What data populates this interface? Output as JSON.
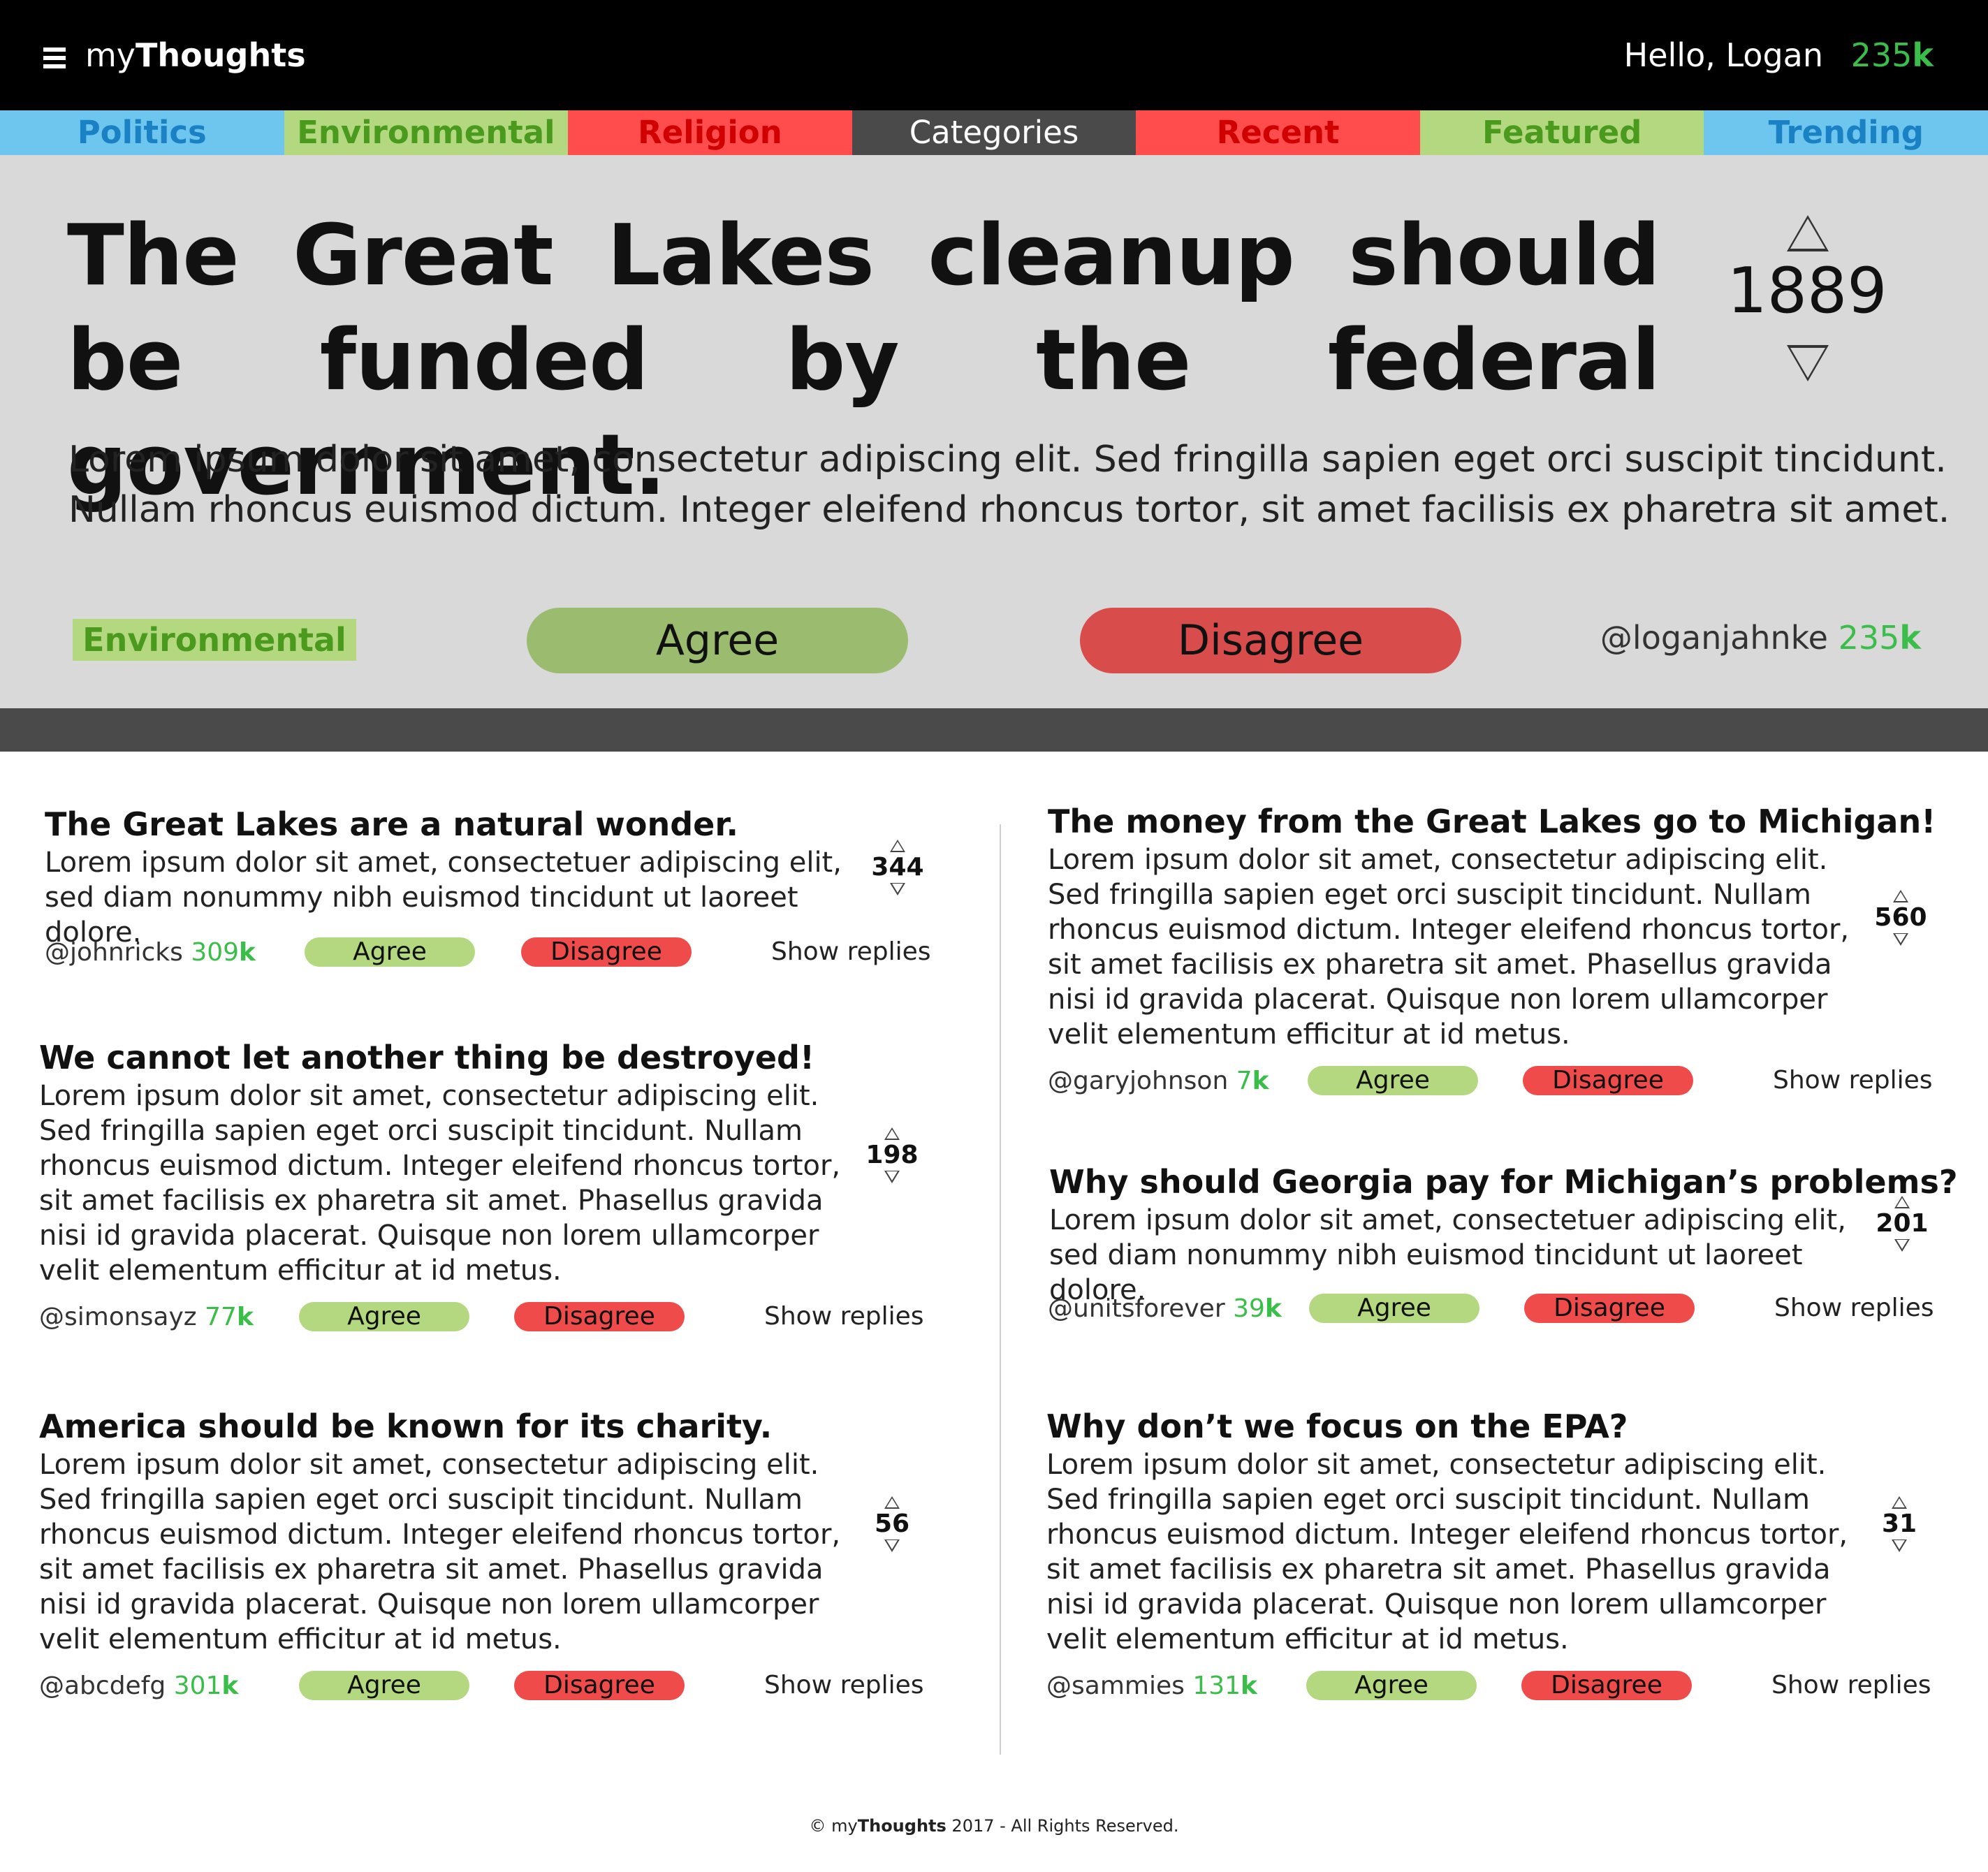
{
  "header": {
    "brand_prefix": "my",
    "brand_bold": "Thoughts",
    "greeting_prefix": "Hello,",
    "user_name": "Logan",
    "points_number": "235",
    "points_suffix": "k"
  },
  "nav": {
    "tabs": [
      {
        "label": "Politics",
        "bg": "#6ec6ee",
        "fg": "#1a82c4"
      },
      {
        "label": "Environmental",
        "bg": "#b3d87f",
        "fg": "#4a9a1e"
      },
      {
        "label": "Religion",
        "bg": "#ff4d4d",
        "fg": "#d00000"
      },
      {
        "label": "Categories",
        "bg": "#4a4a4a",
        "fg": "#ffffff"
      },
      {
        "label": "Recent",
        "bg": "#ff4d4d",
        "fg": "#d00000"
      },
      {
        "label": "Featured",
        "bg": "#b3d87f",
        "fg": "#4a9a1e"
      },
      {
        "label": "Trending",
        "bg": "#6ec6ee",
        "fg": "#1a82c4"
      }
    ]
  },
  "hero": {
    "title": "The Great Lakes cleanup should be funded by the federal government.",
    "votes": "1889",
    "body": "Lorem ipsum dolor sit amet, consectetur adipiscing elit. Sed fringilla sapien eget orci suscipit tincidunt. Nullam rhoncus euismod dictum. Integer eleifend rhoncus tortor, sit amet facilisis ex pharetra sit amet.",
    "category": "Environmental",
    "agree_label": "Agree",
    "disagree_label": "Disagree",
    "author": "@loganjahnke",
    "author_points": "235",
    "author_points_suffix": "k"
  },
  "posts": [
    {
      "title": "The Great Lakes are a natural wonder.",
      "body": "Lorem ipsum dolor sit amet, consectetuer adipiscing elit, sed diam nonummy nibh euismod tincidunt ut laoreet dolore.",
      "votes": "344",
      "author": "@johnricks",
      "points": "309",
      "points_suffix": "k",
      "agree_label": "Agree",
      "disagree_label": "Disagree",
      "replies_label": "Show replies"
    },
    {
      "title": "We cannot let another thing be destroyed!",
      "body": "Lorem ipsum dolor sit amet, consectetur adipiscing elit. Sed fringilla sapien eget orci suscipit tincidunt. Nullam rhoncus euismod dictum. Integer eleifend rhoncus tortor, sit amet facilisis ex pharetra sit amet. Phasellus gravida nisi id gravida placerat. Quisque non lorem ullamcorper velit elementum efficitur at id metus.",
      "votes": "198",
      "author": "@simonsayz",
      "points": "77",
      "points_suffix": "k",
      "agree_label": "Agree",
      "disagree_label": "Disagree",
      "replies_label": "Show replies"
    },
    {
      "title": "America should be known for its charity.",
      "body": "Lorem ipsum dolor sit amet, consectetur adipiscing elit. Sed fringilla sapien eget orci suscipit tincidunt. Nullam rhoncus euismod dictum. Integer eleifend rhoncus tortor, sit amet facilisis ex pharetra sit amet. Phasellus gravida nisi id gravida placerat. Quisque non lorem ullamcorper velit elementum efficitur at id metus.",
      "votes": "56",
      "author": "@abcdefg",
      "points": "301",
      "points_suffix": "k",
      "agree_label": "Agree",
      "disagree_label": "Disagree",
      "replies_label": "Show replies"
    },
    {
      "title": "The money from the Great Lakes go to Michigan!",
      "body": "Lorem ipsum dolor sit amet, consectetur adipiscing elit. Sed fringilla sapien eget orci suscipit tincidunt. Nullam rhoncus euismod dictum. Integer eleifend rhoncus tortor, sit amet facilisis ex pharetra sit amet. Phasellus gravida nisi id gravida placerat. Quisque non lorem ullamcorper velit elementum efficitur at id metus.",
      "votes": "560",
      "author": "@garyjohnson",
      "points": "7",
      "points_suffix": "k",
      "agree_label": "Agree",
      "disagree_label": "Disagree",
      "replies_label": "Show replies"
    },
    {
      "title": "Why should Georgia pay for Michigan’s problems?",
      "body": "Lorem ipsum dolor sit amet, consectetuer adipiscing elit, sed diam nonummy nibh euismod tincidunt ut laoreet dolore.",
      "votes": "201",
      "author": "@unitsforever",
      "points": "39",
      "points_suffix": "k",
      "agree_label": "Agree",
      "disagree_label": "Disagree",
      "replies_label": "Show replies"
    },
    {
      "title": "Why don’t we focus on the EPA?",
      "body": "Lorem ipsum dolor sit amet, consectetur adipiscing elit. Sed fringilla sapien eget orci suscipit tincidunt. Nullam rhoncus euismod dictum. Integer eleifend rhoncus tortor, sit amet facilisis ex pharetra sit amet. Phasellus gravida nisi id gravida placerat. Quisque non lorem ullamcorper velit elementum efficitur at id metus.",
      "votes": "31",
      "author": "@sammies",
      "points": "131",
      "points_suffix": "k",
      "agree_label": "Agree",
      "disagree_label": "Disagree",
      "replies_label": "Show replies"
    }
  ],
  "footer": {
    "prefix": "© my",
    "brand_bold": "Thoughts",
    "suffix": " 2017 - All Rights Reserved."
  },
  "colors": {
    "points_green": "#3bbd4a",
    "agree_green": "#b3d87f",
    "disagree_red": "#ef4b4b",
    "hero_bg": "#d9d9d9"
  }
}
